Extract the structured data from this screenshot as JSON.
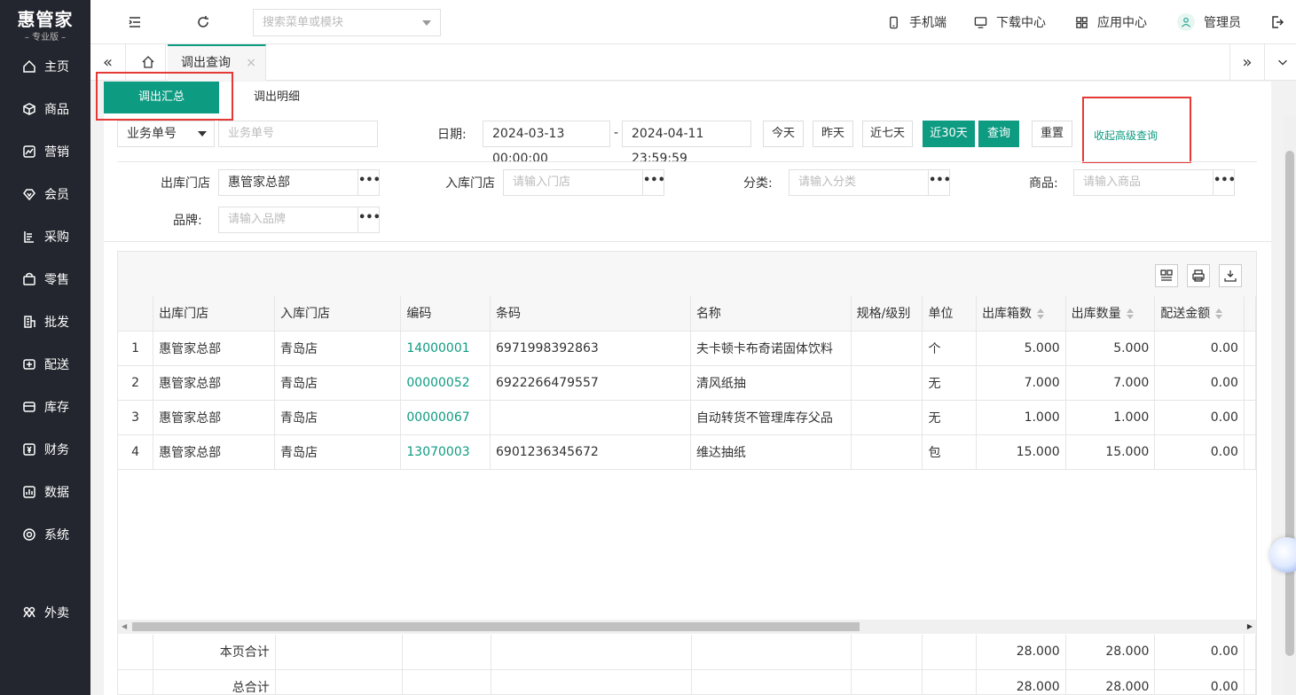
{
  "brand": {
    "name": "惠管家",
    "edition": "专业版"
  },
  "sidebar": {
    "items": [
      {
        "label": "主页",
        "icon": "home-icon"
      },
      {
        "label": "商品",
        "icon": "box-icon"
      },
      {
        "label": "营销",
        "icon": "chart-icon"
      },
      {
        "label": "会员",
        "icon": "diamond-icon"
      },
      {
        "label": "采购",
        "icon": "purchase-icon"
      },
      {
        "label": "零售",
        "icon": "bag-icon"
      },
      {
        "label": "批发",
        "icon": "building-icon"
      },
      {
        "label": "配送",
        "icon": "truck-icon"
      },
      {
        "label": "库存",
        "icon": "inventory-icon"
      },
      {
        "label": "财务",
        "icon": "finance-icon"
      },
      {
        "label": "数据",
        "icon": "data-icon"
      },
      {
        "label": "系统",
        "icon": "settings-icon"
      },
      {
        "label": "外卖",
        "icon": "takeout-icon"
      }
    ]
  },
  "topbar": {
    "search_placeholder": "搜索菜单或模块",
    "mobile": "手机端",
    "download": "下载中心",
    "apps": "应用中心",
    "user": "管理员"
  },
  "tabs": {
    "active": "调出查询",
    "close": "×"
  },
  "subtabs": {
    "summary": "调出汇总",
    "detail": "调出明细"
  },
  "filters": {
    "doc_select": "业务单号",
    "doc_placeholder": "业务单号",
    "date_label": "日期:",
    "date_start": "2024-03-13 00:00:00",
    "date_sep": "-",
    "date_end": "2024-04-11 23:59:59",
    "btn_today": "今天",
    "btn_yesterday": "昨天",
    "btn_7days": "近七天",
    "btn_30days": "近30天",
    "btn_query": "查询",
    "btn_reset": "重置",
    "collapse_link": "收起高级查询",
    "out_store_label": "出库门店",
    "out_store_value": "惠管家总部",
    "in_store_label": "入库门店",
    "in_store_placeholder": "请输入门店",
    "category_label": "分类:",
    "category_placeholder": "请输入分类",
    "product_label": "商品:",
    "product_placeholder": "请输入商品",
    "brand_label": "品牌:",
    "brand_placeholder": "请输入品牌",
    "dots": "•••"
  },
  "table": {
    "columns": [
      "",
      "出库门店",
      "入库门店",
      "编码",
      "条码",
      "名称",
      "规格/级别",
      "单位",
      "出库箱数",
      "出库数量",
      "配送金额"
    ],
    "rows": [
      {
        "idx": "1",
        "out": "惠管家总部",
        "in": "青岛店",
        "code": "14000001",
        "barcode": "6971998392863",
        "name": "夫卡顿卡布奇诺固体饮料",
        "spec": "",
        "unit": "个",
        "boxes": "5.000",
        "qty": "5.000",
        "amount": "0.00"
      },
      {
        "idx": "2",
        "out": "惠管家总部",
        "in": "青岛店",
        "code": "00000052",
        "barcode": "6922266479557",
        "name": "清风纸抽",
        "spec": "",
        "unit": "无",
        "boxes": "7.000",
        "qty": "7.000",
        "amount": "0.00"
      },
      {
        "idx": "3",
        "out": "惠管家总部",
        "in": "青岛店",
        "code": "00000067",
        "barcode": "",
        "name": "自动转货不管理库存父品",
        "spec": "",
        "unit": "无",
        "boxes": "1.000",
        "qty": "1.000",
        "amount": "0.00"
      },
      {
        "idx": "4",
        "out": "惠管家总部",
        "in": "青岛店",
        "code": "13070003",
        "barcode": "6901236345672",
        "name": "维达抽纸",
        "spec": "",
        "unit": "包",
        "boxes": "15.000",
        "qty": "15.000",
        "amount": "0.00"
      }
    ],
    "page_total": {
      "label": "本页合计",
      "boxes": "28.000",
      "qty": "28.000",
      "amount": "0.00"
    },
    "grand_total": {
      "label": "总合计",
      "boxes": "28.000",
      "qty": "28.000",
      "amount": "0.00"
    }
  },
  "colors": {
    "accent": "#0d9b82",
    "sidebar": "#23262e",
    "highlight": "#e53935"
  }
}
